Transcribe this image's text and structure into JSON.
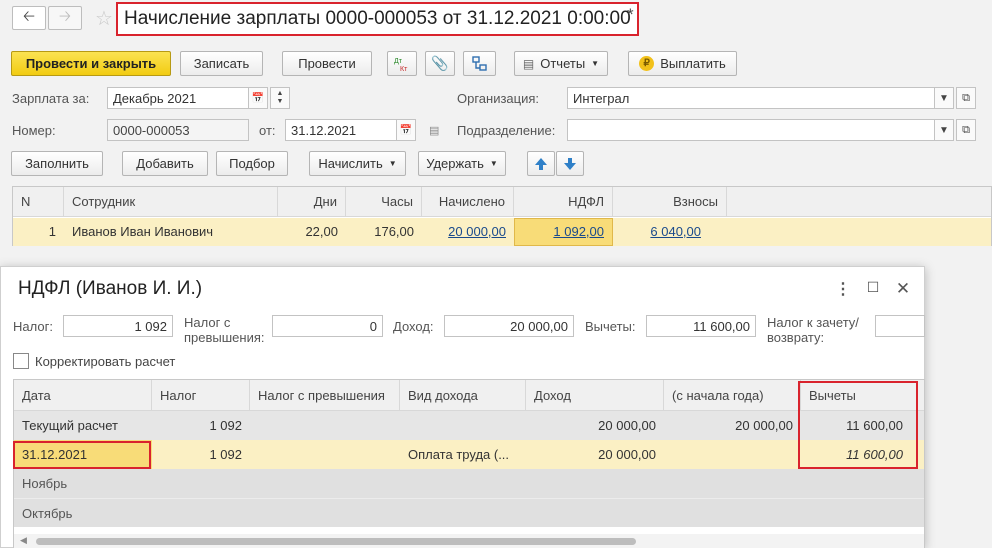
{
  "window": {
    "title": "Начисление зарплаты 0000-000053 от 31.12.2021 0:00:00",
    "modified_mark": "*"
  },
  "nav": {
    "back_icon": "arrow-left-icon",
    "forward_icon": "arrow-right-icon",
    "favorite_icon": "star-icon"
  },
  "toolbar": {
    "post_and_close": "Провести и закрыть",
    "save": "Записать",
    "post": "Провести",
    "dt_kt_icon": "Дт Кт",
    "reports": "Отчеты",
    "pay": "Выплатить"
  },
  "form": {
    "salary_for_label": "Зарплата за:",
    "salary_for_value": "Декабрь 2021",
    "organization_label": "Организация:",
    "organization_value": "Интеграл",
    "number_label": "Номер:",
    "number_value": "0000-000053",
    "date_label": "от:",
    "date_value": "31.12.2021",
    "division_label": "Подразделение:",
    "division_value": ""
  },
  "grid_toolbar": {
    "fill": "Заполнить",
    "add": "Добавить",
    "pick": "Подбор",
    "accrue": "Начислить",
    "withhold": "Удержать"
  },
  "grid": {
    "columns": [
      "N",
      "Сотрудник",
      "Дни",
      "Часы",
      "Начислено",
      "НДФЛ",
      "Взносы"
    ],
    "rows": [
      {
        "n": "1",
        "employee": "Иванов Иван Иванович",
        "days": "22,00",
        "hours": "176,00",
        "accrued": "20 000,00",
        "ndfl": "1 092,00",
        "contributions": "6 040,00"
      }
    ]
  },
  "dialog": {
    "title": "НДФЛ (Иванов И. И.)",
    "tax_label": "Налог:",
    "tax_value": "1 092",
    "excess_tax_label_1": "Налог с",
    "excess_tax_label_2": "превышения:",
    "excess_tax_value": "0",
    "income_label": "Доход:",
    "income_value": "20 000,00",
    "deductions_label": "Вычеты:",
    "deductions_value": "11 600,00",
    "offset_label_1": "Налог к зачету/",
    "offset_label_2": "возврату:",
    "offset_value": "",
    "correct_calc_label": "Корректировать расчет",
    "correct_calc_checked": false,
    "table": {
      "columns": [
        "Дата",
        "Налог",
        "Налог с превышения",
        "Вид дохода",
        "Доход",
        "(с начала года)",
        "Вычеты"
      ],
      "rows": [
        {
          "date": "Текущий расчет",
          "tax": "1 092",
          "excess": "",
          "income_type": "",
          "income": "20 000,00",
          "ytd": "20 000,00",
          "deductions": "11 600,00"
        },
        {
          "date": "31.12.2021",
          "tax": "1 092",
          "excess": "",
          "income_type": "Оплата труда (...",
          "income": "20 000,00",
          "ytd": "",
          "deductions": "11 600,00"
        },
        {
          "date": "Ноябрь",
          "tax": "",
          "excess": "",
          "income_type": "",
          "income": "",
          "ytd": "",
          "deductions": ""
        },
        {
          "date": "Октябрь",
          "tax": "",
          "excess": "",
          "income_type": "",
          "income": "",
          "ytd": "",
          "deductions": ""
        }
      ]
    }
  },
  "colors": {
    "highlight_red": "#d9232d",
    "primary_yellow": "#f2cc12",
    "row_yellow": "#fbf0c4",
    "link_blue": "#1a4a8c"
  }
}
